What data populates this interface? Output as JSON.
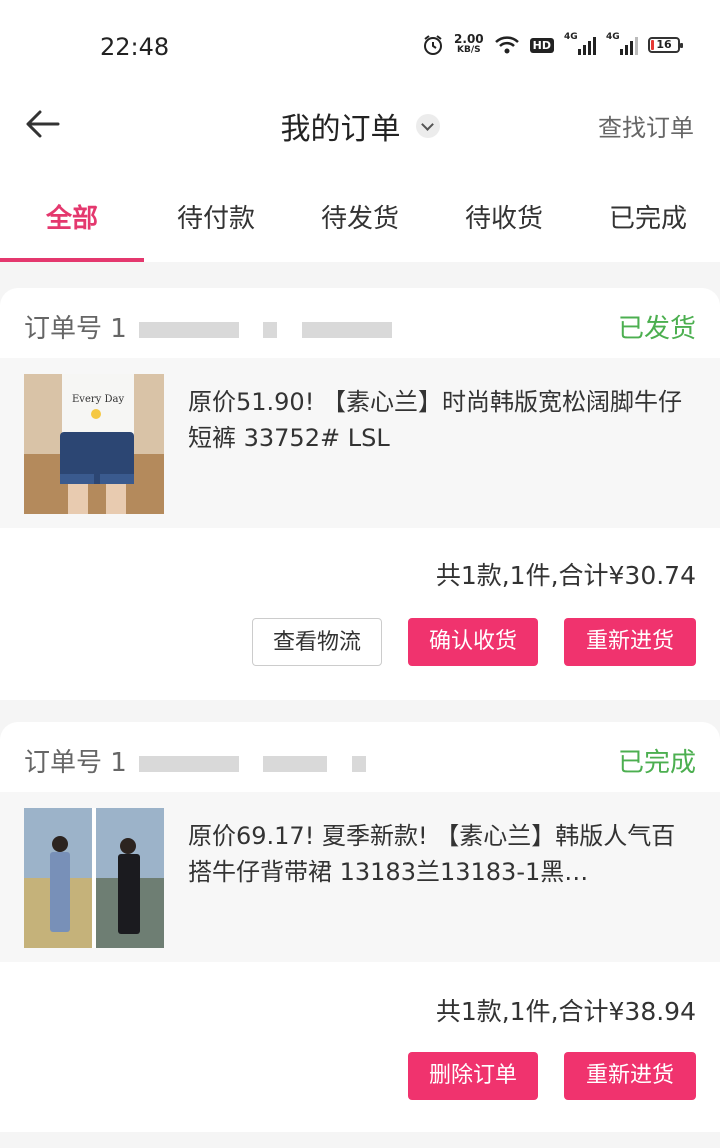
{
  "status_bar": {
    "time": "22:48",
    "net_speed": "2.00",
    "net_unit": "KB/S",
    "hd_badge": "HD",
    "sig1_label": "4G",
    "sig2_label": "4G",
    "battery": "16",
    "icons": [
      "alarm-icon",
      "wifi-icon",
      "signal-icon",
      "battery-icon"
    ]
  },
  "header": {
    "title": "我的订单",
    "search_label": "查找订单",
    "icons": [
      "back-arrow-icon",
      "chevron-down-icon"
    ]
  },
  "tabs": [
    "全部",
    "待付款",
    "待发货",
    "待收货",
    "已完成"
  ],
  "accent_color": "#f0336e",
  "status_color": "#4caf50",
  "orders": [
    {
      "order_label": "订单号",
      "order_no_visible": "1",
      "status": "已发货",
      "product_name": "原价51.90! 【素心兰】时尚韩版宽松阔脚牛仔短裤 33752# LSL",
      "summary": "共1款,1件,合计¥30.74",
      "buttons": [
        "查看物流",
        "确认收货",
        "重新进货"
      ],
      "thumb_text": "Every Day"
    },
    {
      "order_label": "订单号",
      "order_no_visible": "1",
      "status": "已完成",
      "product_name": "原价69.17! 夏季新款! 【素心兰】韩版人气百搭牛仔背带裙 13183兰13183-1黑…",
      "summary": "共1款,1件,合计¥38.94",
      "buttons": [
        "删除订单",
        "重新进货"
      ]
    }
  ]
}
